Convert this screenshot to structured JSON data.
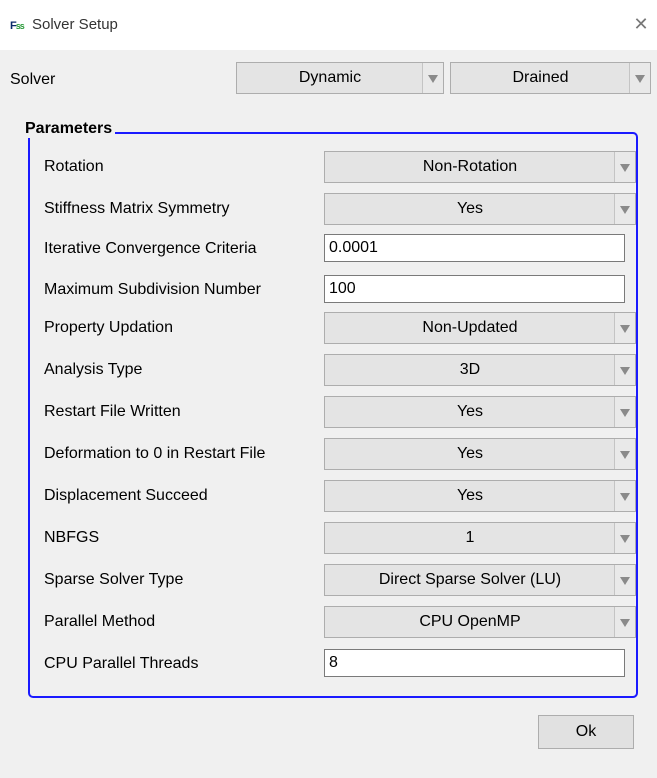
{
  "window": {
    "title": "Solver Setup",
    "icon": "fss-app-icon",
    "close_glyph": "✕"
  },
  "solver": {
    "label": "Solver",
    "mode": "Dynamic",
    "drainage": "Drained"
  },
  "parameters": {
    "title": "Parameters",
    "rows": [
      {
        "label": "Rotation",
        "value": "Non-Rotation"
      },
      {
        "label": "Stiffness Matrix Symmetry",
        "value": "Yes"
      },
      {
        "label": "Iterative Convergence Criteria",
        "value": "0.0001"
      },
      {
        "label": "Maximum Subdivision Number",
        "value": "100"
      },
      {
        "label": "Property Updation",
        "value": "Non-Updated"
      },
      {
        "label": "Analysis Type",
        "value": "3D"
      },
      {
        "label": "Restart File Written",
        "value": "Yes"
      },
      {
        "label": "Deformation to 0 in Restart File",
        "value": "Yes"
      },
      {
        "label": "Displacement Succeed",
        "value": "Yes"
      },
      {
        "label": "NBFGS",
        "value": "1"
      },
      {
        "label": "Sparse Solver Type",
        "value": "Direct Sparse Solver (LU)"
      },
      {
        "label": "Parallel Method",
        "value": "CPU OpenMP"
      },
      {
        "label": "CPU Parallel Threads",
        "value": "8"
      }
    ]
  },
  "buttons": {
    "ok_label": "Ok"
  }
}
